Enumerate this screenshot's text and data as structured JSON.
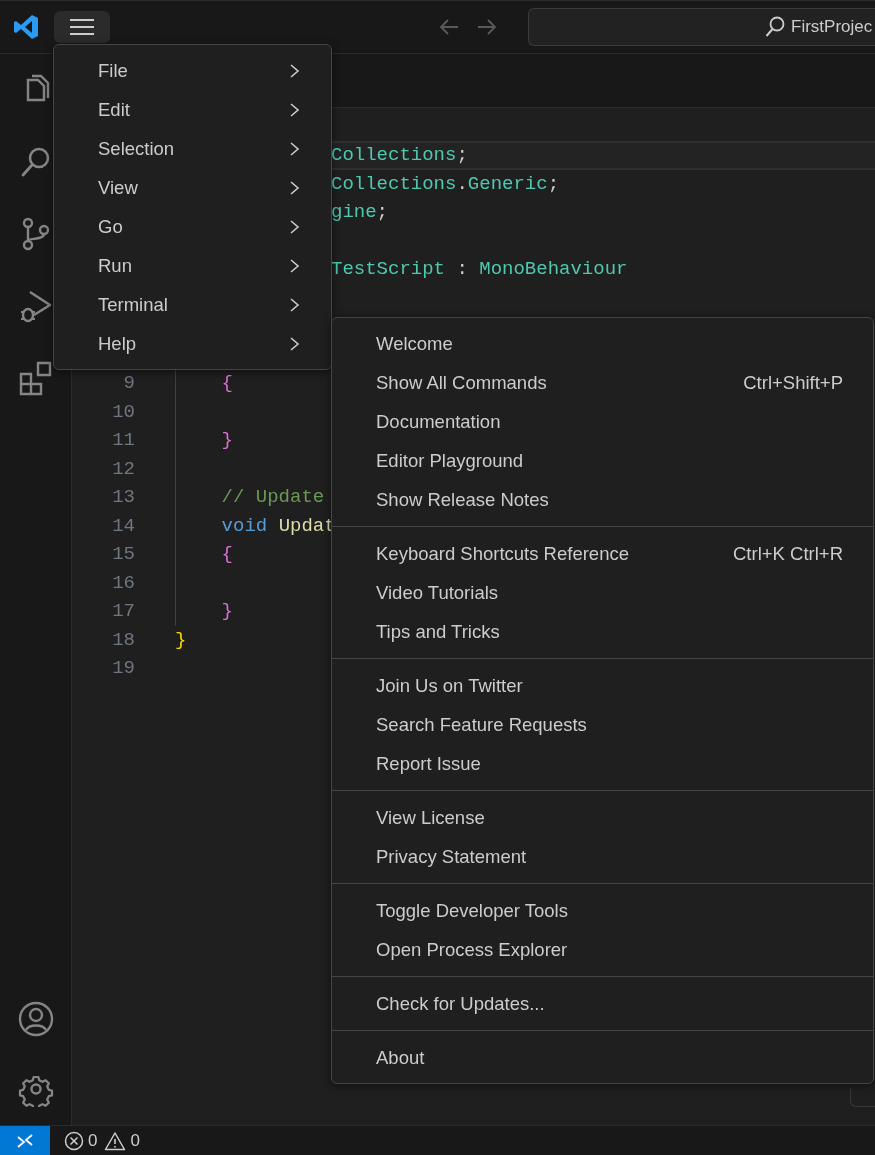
{
  "title_bar": {
    "menu_button": {
      "pressed": true
    },
    "back": {
      "disabled": true
    },
    "forward": {
      "disabled": true
    },
    "search": {
      "value": "FirstProjec"
    }
  },
  "code": {
    "lines": [
      {
        "kind": "clipped",
        "current": true,
        "tokens": [
          {
            "text": "Collections",
            "kind": "type"
          },
          {
            "text": ";",
            "kind": "plain"
          }
        ]
      },
      {
        "kind": "clipped",
        "current": false,
        "tokens": [
          {
            "text": "Collections",
            "kind": "type"
          },
          {
            "text": ".",
            "kind": "plain"
          },
          {
            "text": "Generic",
            "kind": "type"
          },
          {
            "text": ";",
            "kind": "plain"
          }
        ]
      },
      {
        "kind": "clipped",
        "current": false,
        "tokens": [
          {
            "text": "gine",
            "kind": "type"
          },
          {
            "text": ";",
            "kind": "plain"
          }
        ]
      },
      {
        "kind": "blank",
        "current": false
      },
      {
        "kind": "clipped",
        "current": false,
        "tokens": [
          {
            "text": "TestScript",
            "kind": "type"
          },
          {
            "text": " : ",
            "kind": "plain"
          },
          {
            "text": "MonoBehaviour",
            "kind": "type"
          }
        ]
      },
      {
        "kind": "blank",
        "current": false
      },
      {
        "kind": "blank"
      },
      {
        "kind": "blank"
      },
      {
        "kind": "code",
        "number": "9",
        "current": false,
        "guide": true,
        "tokens": [
          {
            "text": "    {",
            "kind": "brace2"
          }
        ]
      },
      {
        "kind": "code",
        "number": "10",
        "current": false,
        "guide": true
      },
      {
        "kind": "code",
        "number": "11",
        "current": false,
        "guide": true,
        "tokens": [
          {
            "text": "    }",
            "kind": "brace2"
          }
        ]
      },
      {
        "kind": "code",
        "number": "12",
        "current": false,
        "guide": true
      },
      {
        "kind": "code",
        "number": "13",
        "current": false,
        "guide": true,
        "tokens": [
          {
            "text": "    // Update",
            "kind": "comment"
          }
        ]
      },
      {
        "kind": "code",
        "number": "14",
        "current": false,
        "guide": true,
        "tokens": [
          {
            "text": "    void",
            "kind": "keyword"
          },
          {
            "text": " Updat",
            "kind": "function"
          }
        ]
      },
      {
        "kind": "code",
        "number": "15",
        "current": false,
        "guide": true,
        "tokens": [
          {
            "text": "    {",
            "kind": "brace2"
          }
        ]
      },
      {
        "kind": "code",
        "number": "16",
        "current": false,
        "guide": true
      },
      {
        "kind": "code",
        "number": "17",
        "current": false,
        "guide": true,
        "tokens": [
          {
            "text": "    }",
            "kind": "brace2"
          }
        ]
      },
      {
        "kind": "code",
        "number": "18",
        "current": false,
        "guide": false,
        "tokens": [
          {
            "text": "}",
            "kind": "brace1"
          }
        ]
      },
      {
        "kind": "code",
        "number": "19",
        "current": false,
        "guide": false
      }
    ]
  },
  "main_menu": {
    "items": [
      {
        "label": "File"
      },
      {
        "label": "Edit"
      },
      {
        "label": "Selection"
      },
      {
        "label": "View"
      },
      {
        "label": "Go"
      },
      {
        "label": "Run"
      },
      {
        "label": "Terminal"
      },
      {
        "label": "Help"
      }
    ]
  },
  "help_menu": {
    "groups": [
      {
        "items": [
          {
            "label": "Welcome"
          },
          {
            "label": "Show All Commands",
            "shortcut": "Ctrl+Shift+P"
          },
          {
            "label": "Documentation"
          },
          {
            "label": "Editor Playground"
          },
          {
            "label": "Show Release Notes"
          }
        ]
      },
      {
        "items": [
          {
            "label": "Keyboard Shortcuts Reference",
            "shortcut": "Ctrl+K Ctrl+R"
          },
          {
            "label": "Video Tutorials"
          },
          {
            "label": "Tips and Tricks"
          }
        ]
      },
      {
        "items": [
          {
            "label": "Join Us on Twitter"
          },
          {
            "label": "Search Feature Requests"
          },
          {
            "label": "Report Issue"
          }
        ]
      },
      {
        "items": [
          {
            "label": "View License"
          },
          {
            "label": "Privacy Statement"
          }
        ]
      },
      {
        "items": [
          {
            "label": "Toggle Developer Tools"
          },
          {
            "label": "Open Process Explorer"
          }
        ]
      },
      {
        "items": [
          {
            "label": "Check for Updates..."
          }
        ]
      },
      {
        "items": [
          {
            "label": "About"
          }
        ]
      }
    ]
  },
  "status_bar": {
    "errors": "0",
    "warnings": "0"
  }
}
